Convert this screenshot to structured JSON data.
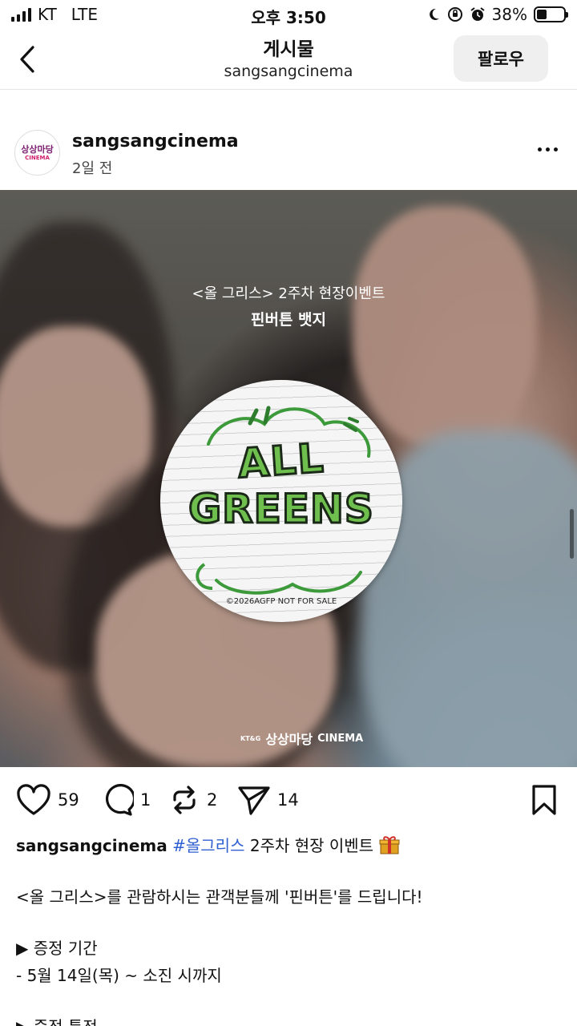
{
  "status_bar": {
    "carrier": "KT",
    "network": "LTE",
    "time": "오후 3:50",
    "battery_percent": "38%",
    "battery_level": 0.38
  },
  "nav": {
    "title": "게시물",
    "subtitle": "sangsangcinema",
    "follow_label": "팔로우"
  },
  "post": {
    "username": "sangsangcinema",
    "time_ago": "2일 전",
    "avatar_text_main": "상상마당",
    "avatar_text_sub": "CINEMA",
    "image": {
      "line1": "<올 그리스> 2주차 현장이벤트",
      "line2": "핀버튼 뱃지",
      "badge_line1": "ALL",
      "badge_line2": "GREENS",
      "badge_copyright": "©2026AGFP   NOT FOR SALE",
      "watermark_prefix": "KT&G",
      "watermark_main": "상상마당",
      "watermark_suffix": "CINEMA"
    },
    "actions": {
      "likes": "59",
      "comments": "1",
      "reposts": "2",
      "shares": "14"
    },
    "caption": {
      "username": "sangsangcinema",
      "hashtag": "#올그리스",
      "first_line_rest": " 2주차 현장 이벤트 ",
      "line2": "<올 그리스>를 관람하시는 관객분들께 '핀버튼'를 드립니다!",
      "line3": "▶ 증정 기간",
      "line4": "- 5월 14일(목) ~ 소진 시까지",
      "line5": "▶ 증정 특전"
    }
  }
}
